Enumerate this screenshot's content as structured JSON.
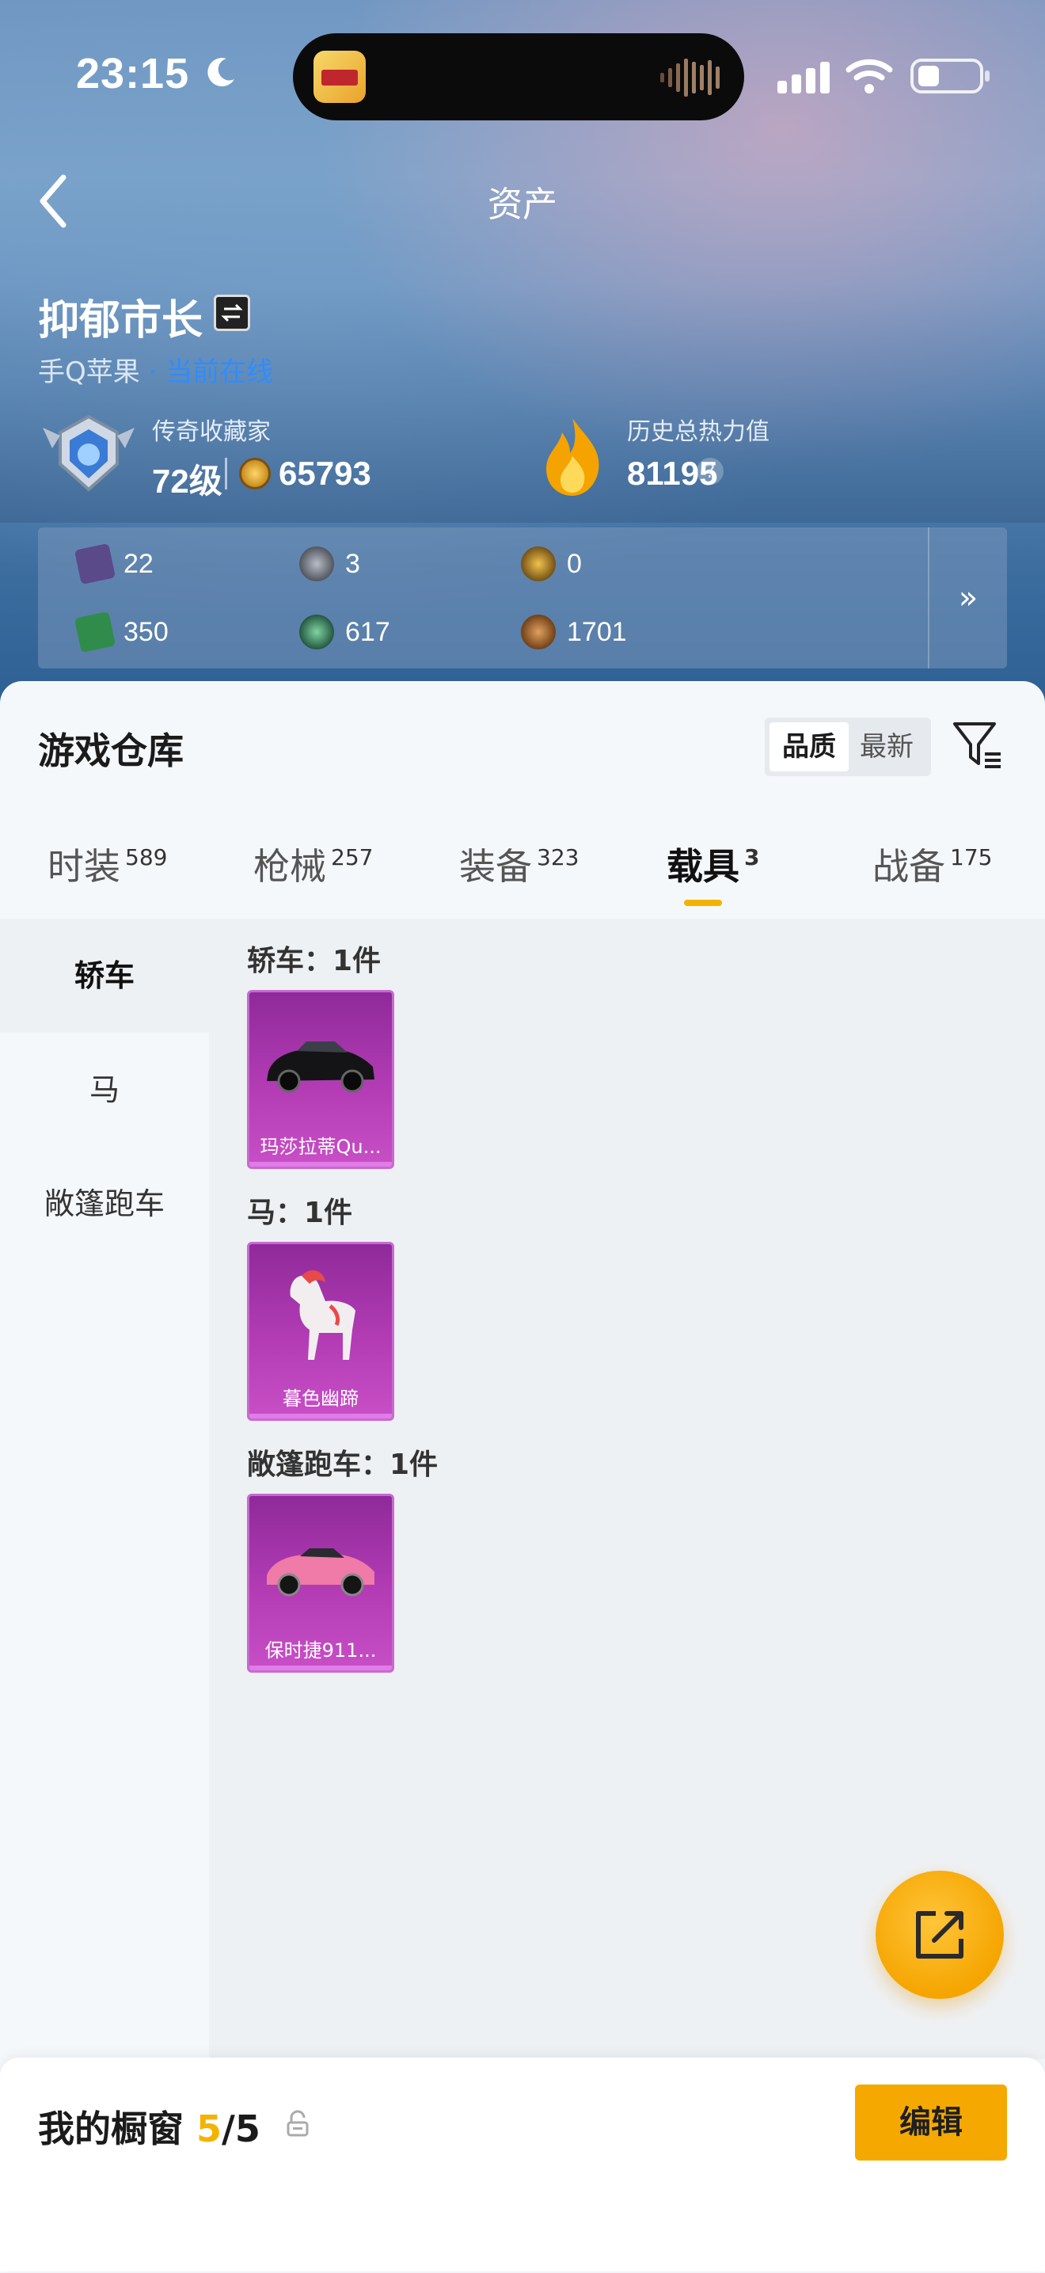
{
  "status_bar": {
    "time": "23:15"
  },
  "nav": {
    "title": "资产"
  },
  "profile": {
    "name": "抑郁市长",
    "platform": "手Q苹果",
    "platform_status": "· 当前在线",
    "collector_label": "传奇收藏家",
    "level": "72级",
    "points": "65793",
    "heat_label": "历史总热力值",
    "heat_value": "81195",
    "help": "?"
  },
  "resources": {
    "items": [
      {
        "value": "22",
        "icon": "purple-card-icon",
        "color": "#5a4a8a"
      },
      {
        "value": "3",
        "icon": "silver-coin-icon",
        "color": "#6b6f78"
      },
      {
        "value": "0",
        "icon": "gold-badge-icon",
        "color": "#b7861f"
      },
      {
        "value": "350",
        "icon": "green-card-icon",
        "color": "#2f8c4a"
      },
      {
        "value": "617",
        "icon": "green-orb-icon",
        "color": "#3c8f6a"
      },
      {
        "value": "1701",
        "icon": "bronze-coin-icon",
        "color": "#a7642a"
      }
    ],
    "more": "»"
  },
  "warehouse": {
    "title": "游戏仓库",
    "sort_quality": "品质",
    "sort_latest": "最新"
  },
  "tabs": [
    {
      "label": "时装",
      "count": "589"
    },
    {
      "label": "枪械",
      "count": "257"
    },
    {
      "label": "装备",
      "count": "323"
    },
    {
      "label": "载具",
      "count": "3"
    },
    {
      "label": "战备",
      "count": "175"
    }
  ],
  "categories": [
    "轿车",
    "马",
    "敞篷跑车"
  ],
  "groups": [
    {
      "title": "轿车：1件",
      "item": "玛莎拉蒂Qu..."
    },
    {
      "title": "马：1件",
      "item": "暮色幽蹄"
    },
    {
      "title": "敞篷跑车：1件",
      "item": "保时捷911..."
    }
  ],
  "showcase": {
    "label": "我的橱窗",
    "current": "5",
    "total": "/5",
    "edit": "编辑"
  },
  "colors": {
    "accent": "#f4b300",
    "card": "#b33cb4",
    "link": "#2f8cff"
  }
}
